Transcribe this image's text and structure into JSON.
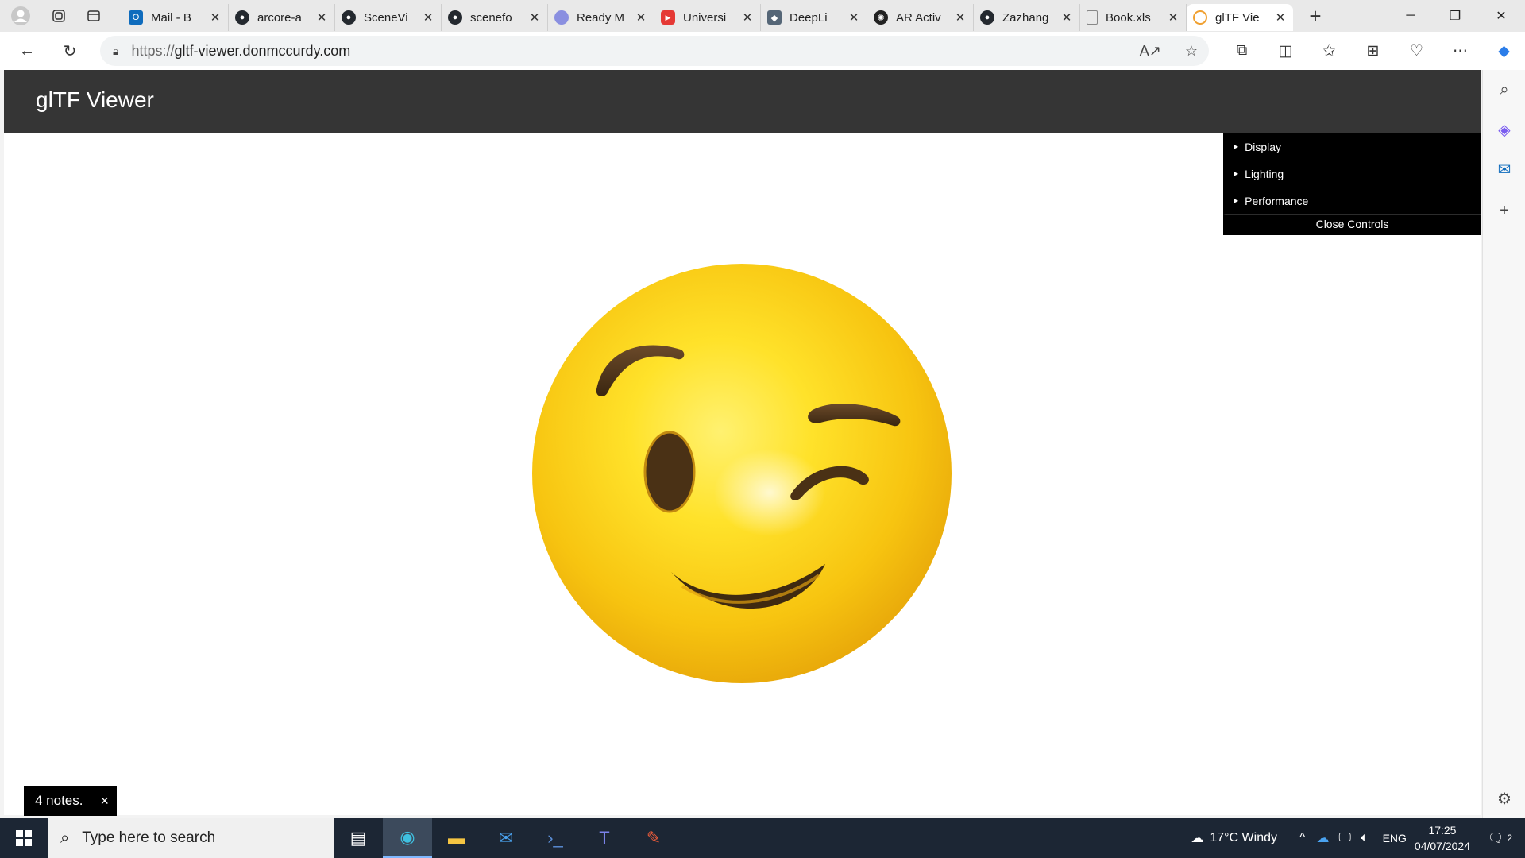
{
  "browser": {
    "tabs": [
      {
        "label": "Mail - B",
        "favicon": "outlook",
        "color": "#0f6cbd"
      },
      {
        "label": "arcore-a",
        "favicon": "github",
        "color": "#24292f"
      },
      {
        "label": "SceneVi",
        "favicon": "github",
        "color": "#24292f"
      },
      {
        "label": "scenefo",
        "favicon": "github",
        "color": "#24292f"
      },
      {
        "label": "Ready M",
        "favicon": "readyplayerme",
        "color": "#8a8fe0"
      },
      {
        "label": "Universi",
        "favicon": "youtube",
        "color": "#e53935"
      },
      {
        "label": "DeepLi",
        "favicon": "deeplearning",
        "color": "#556677"
      },
      {
        "label": "AR Activ",
        "favicon": "openai",
        "color": "#222222"
      },
      {
        "label": "Zazhang",
        "favicon": "github",
        "color": "#24292f"
      },
      {
        "label": "Book.xls",
        "favicon": "document",
        "color": "#888888"
      },
      {
        "label": "glTF Vie",
        "favicon": "gltf",
        "color": "#f0a030"
      }
    ],
    "new_tab": "+",
    "url_protocol": "https://",
    "url_host": "gltf-viewer.donmccurdy.com"
  },
  "page": {
    "title": "glTF Viewer",
    "controls": {
      "folders": [
        "Display",
        "Lighting",
        "Performance"
      ],
      "close_label": "Close Controls"
    },
    "notes": {
      "label": "4 notes.",
      "close": "×"
    },
    "model": "winking-face-emoji"
  },
  "taskbar": {
    "search_placeholder": "Type here to search",
    "weather": "17°C  Windy",
    "language": "ENG",
    "time": "17:25",
    "date": "04/07/2024",
    "notifications": "2"
  }
}
